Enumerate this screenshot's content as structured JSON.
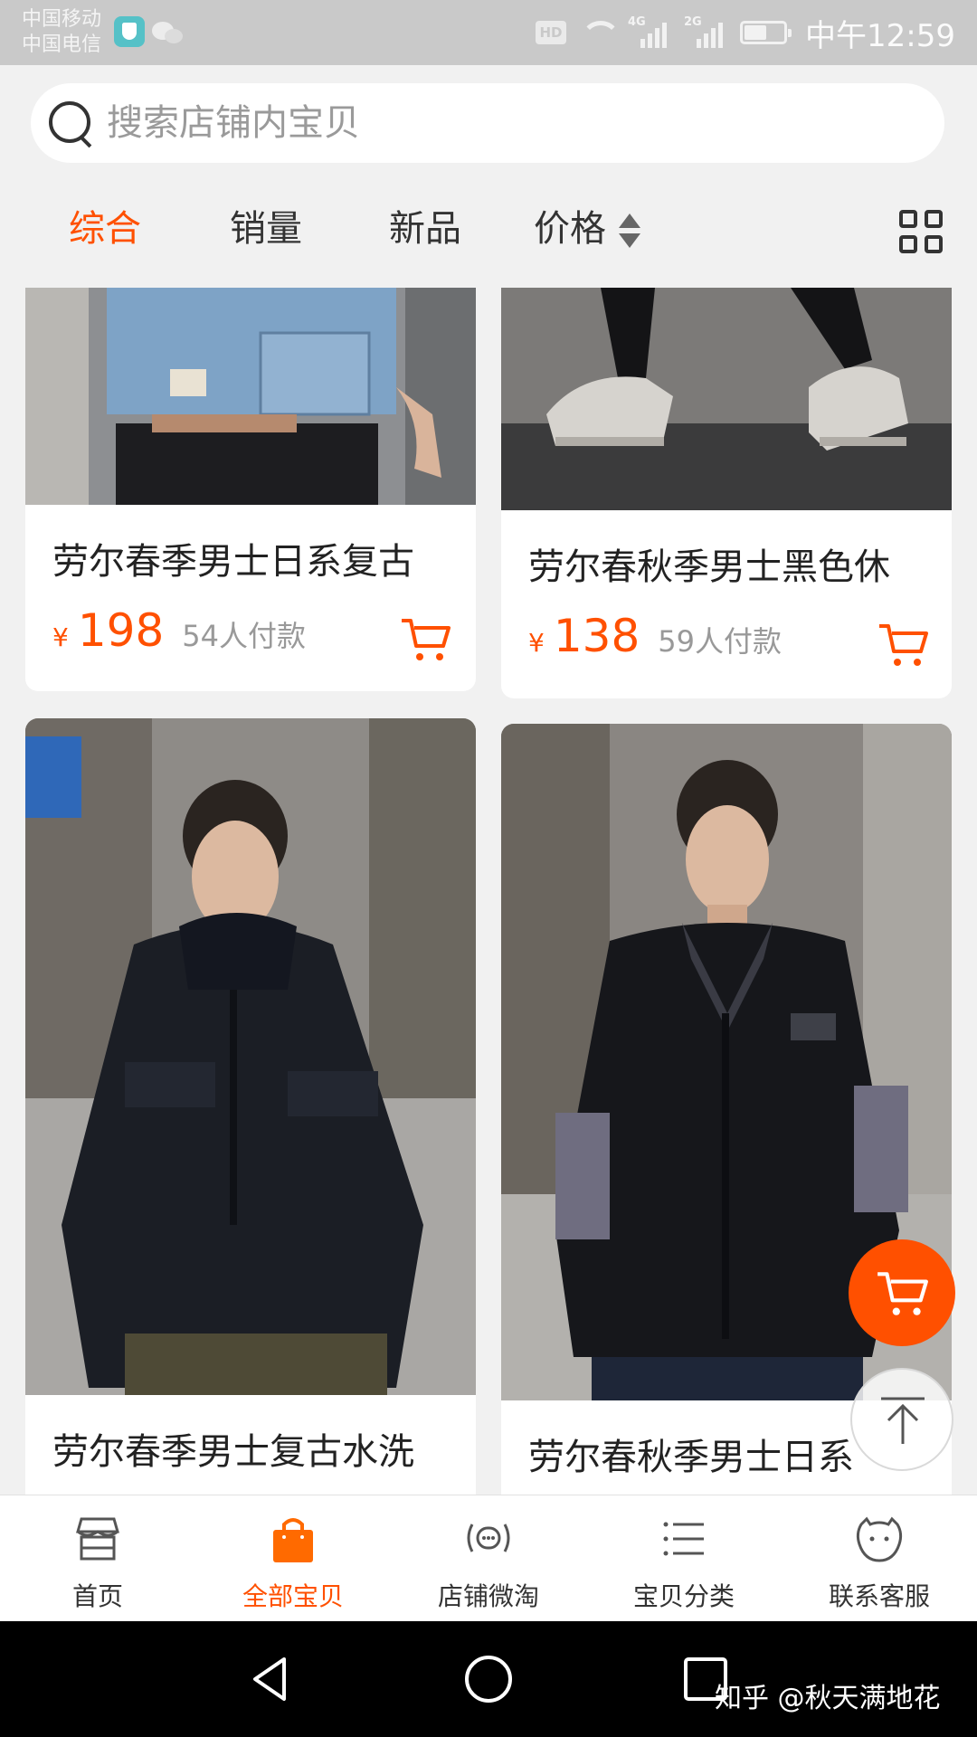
{
  "status_bar": {
    "carrier_1": "中国移动",
    "carrier_2": "中国电信",
    "hd": "HD",
    "net_1": "4G",
    "net_2": "2G",
    "time": "中午12:59"
  },
  "search": {
    "placeholder": "搜索店铺内宝贝"
  },
  "sort_tabs": [
    {
      "label": "综合",
      "active": true
    },
    {
      "label": "销量",
      "active": false
    },
    {
      "label": "新品",
      "active": false
    },
    {
      "label": "价格",
      "active": false
    }
  ],
  "products": [
    {
      "title": "劳尔春季男士日系复古",
      "currency": "¥",
      "price": "198",
      "sold": "54人付款"
    },
    {
      "title": "劳尔春秋季男士黑色休",
      "currency": "¥",
      "price": "138",
      "sold": "59人付款"
    },
    {
      "title": "劳尔春季男士复古水洗"
    },
    {
      "title": "劳尔春秋季男士日系"
    }
  ],
  "bottom_tabs": [
    {
      "label": "首页",
      "icon": "store-icon"
    },
    {
      "label": "全部宝贝",
      "icon": "bag-icon",
      "active": true
    },
    {
      "label": "店铺微淘",
      "icon": "broadcast-icon"
    },
    {
      "label": "宝贝分类",
      "icon": "list-icon"
    },
    {
      "label": "联系客服",
      "icon": "chat-face-icon"
    }
  ],
  "watermark": "知乎 @秋天满地花",
  "colors": {
    "accent": "#ff5000",
    "background": "#f1f1f1"
  }
}
